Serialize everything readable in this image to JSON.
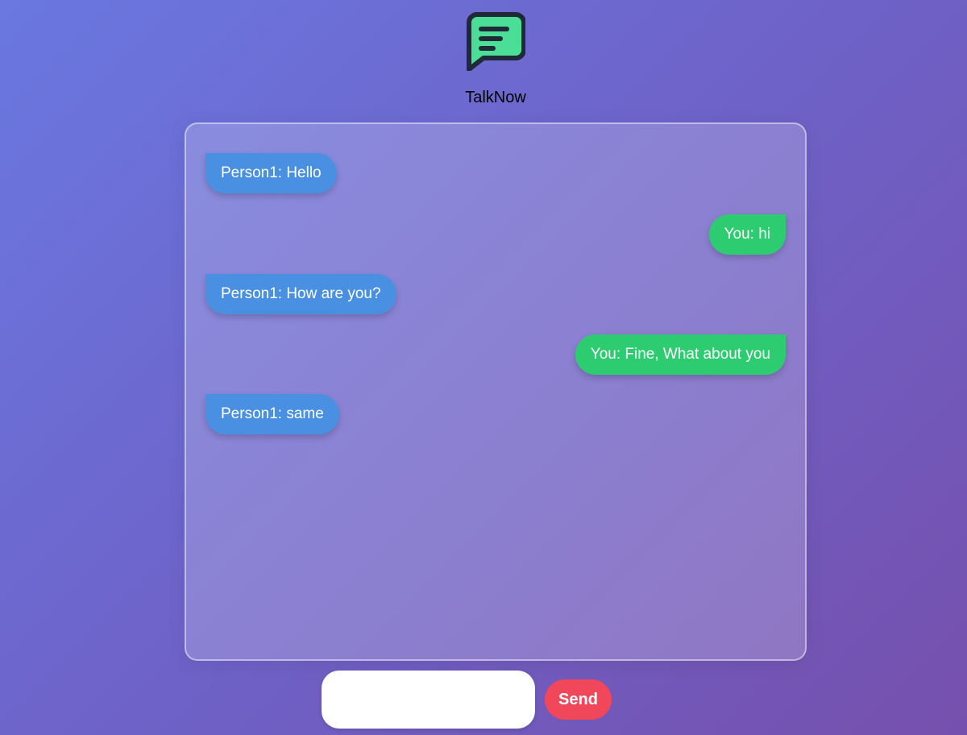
{
  "app": {
    "title": "TalkNow",
    "logo_icon": "chat-bubble-icon",
    "logo_color": "#4ade96"
  },
  "messages": [
    {
      "sender": "them",
      "text": "Person1: Hello"
    },
    {
      "sender": "me",
      "text": "You: hi"
    },
    {
      "sender": "them",
      "text": "Person1: How are you?"
    },
    {
      "sender": "me",
      "text": "You: Fine, What about you"
    },
    {
      "sender": "them",
      "text": "Person1: same"
    }
  ],
  "composer": {
    "input_value": "",
    "input_placeholder": "",
    "send_label": "Send"
  },
  "colors": {
    "incoming_bubble": "#4a90e2",
    "outgoing_bubble": "#2ecc71",
    "send_button": "#f0475a"
  }
}
